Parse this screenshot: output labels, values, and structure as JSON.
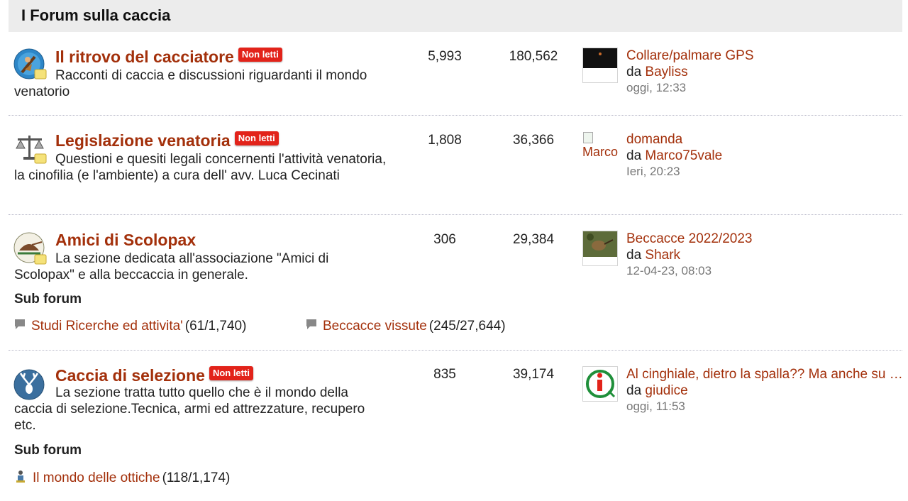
{
  "header": {
    "title": "I Forum sulla caccia"
  },
  "badge_label": "Non letti",
  "by_label": "da",
  "forums": [
    {
      "title": "Il ritrovo del cacciatore",
      "unread": true,
      "icon": "hunter-icon",
      "description": "Racconti di caccia e discussioni riguardanti il mondo venatorio",
      "threads": "5,993",
      "posts": "180,562",
      "last": {
        "title": "Collare/palmare GPS",
        "user": "Bayliss",
        "date": "oggi, 12:33",
        "thumb": "dark-photo-thumbnail"
      }
    },
    {
      "title": "Legislazione venatoria",
      "unread": true,
      "icon": "scales-icon",
      "description": "Questioni e quesiti legali concernenti l'attività venatoria, la cinofilia (e l'ambiente) a cura dell' avv. Luca Cecinati",
      "threads": "1,808",
      "posts": "36,366",
      "last": {
        "title": "domanda",
        "user": "Marco75vale",
        "date": "Ieri, 20:23",
        "thumb_alt": "Marco"
      }
    },
    {
      "title": "Amici di Scolopax",
      "unread": false,
      "icon": "woodcock-logo-icon",
      "description": "La sezione dedicata all'associazione \"Amici di Scolopax\" e alla beccaccia in generale.",
      "threads": "306",
      "posts": "29,384",
      "last": {
        "title": "Beccacce 2022/2023",
        "user": "Shark",
        "date": "12-04-23, 08:03",
        "thumb": "woodcock-photo-thumbnail"
      },
      "subforum_label": "Sub forum",
      "subforums": [
        {
          "name": "Studi Ricerche ed attivita'",
          "count": "(61/1,740)"
        },
        {
          "name": "Beccacce vissute",
          "count": "(245/27,644)"
        }
      ]
    },
    {
      "title": "Caccia di selezione",
      "unread": true,
      "icon": "deer-icon",
      "description": "La sezione tratta tutto quello che è il mondo della caccia di selezione.Tecnica, armi ed attrezzature, recupero etc.",
      "threads": "835",
      "posts": "39,174",
      "last": {
        "title": "Al cinghiale, dietro la spalla?? Ma anche su tutto il resto!!",
        "user": "giudice",
        "date": "oggi, 11:53",
        "thumb": "info-logo-thumbnail"
      },
      "subforum_label": "Sub forum",
      "subforums": [
        {
          "name": "Il mondo delle ottiche",
          "count": "(118/1,174)"
        }
      ]
    }
  ],
  "colors": {
    "link": "#a3300b",
    "badge": "#e2231a",
    "header_bg": "#ececec"
  }
}
